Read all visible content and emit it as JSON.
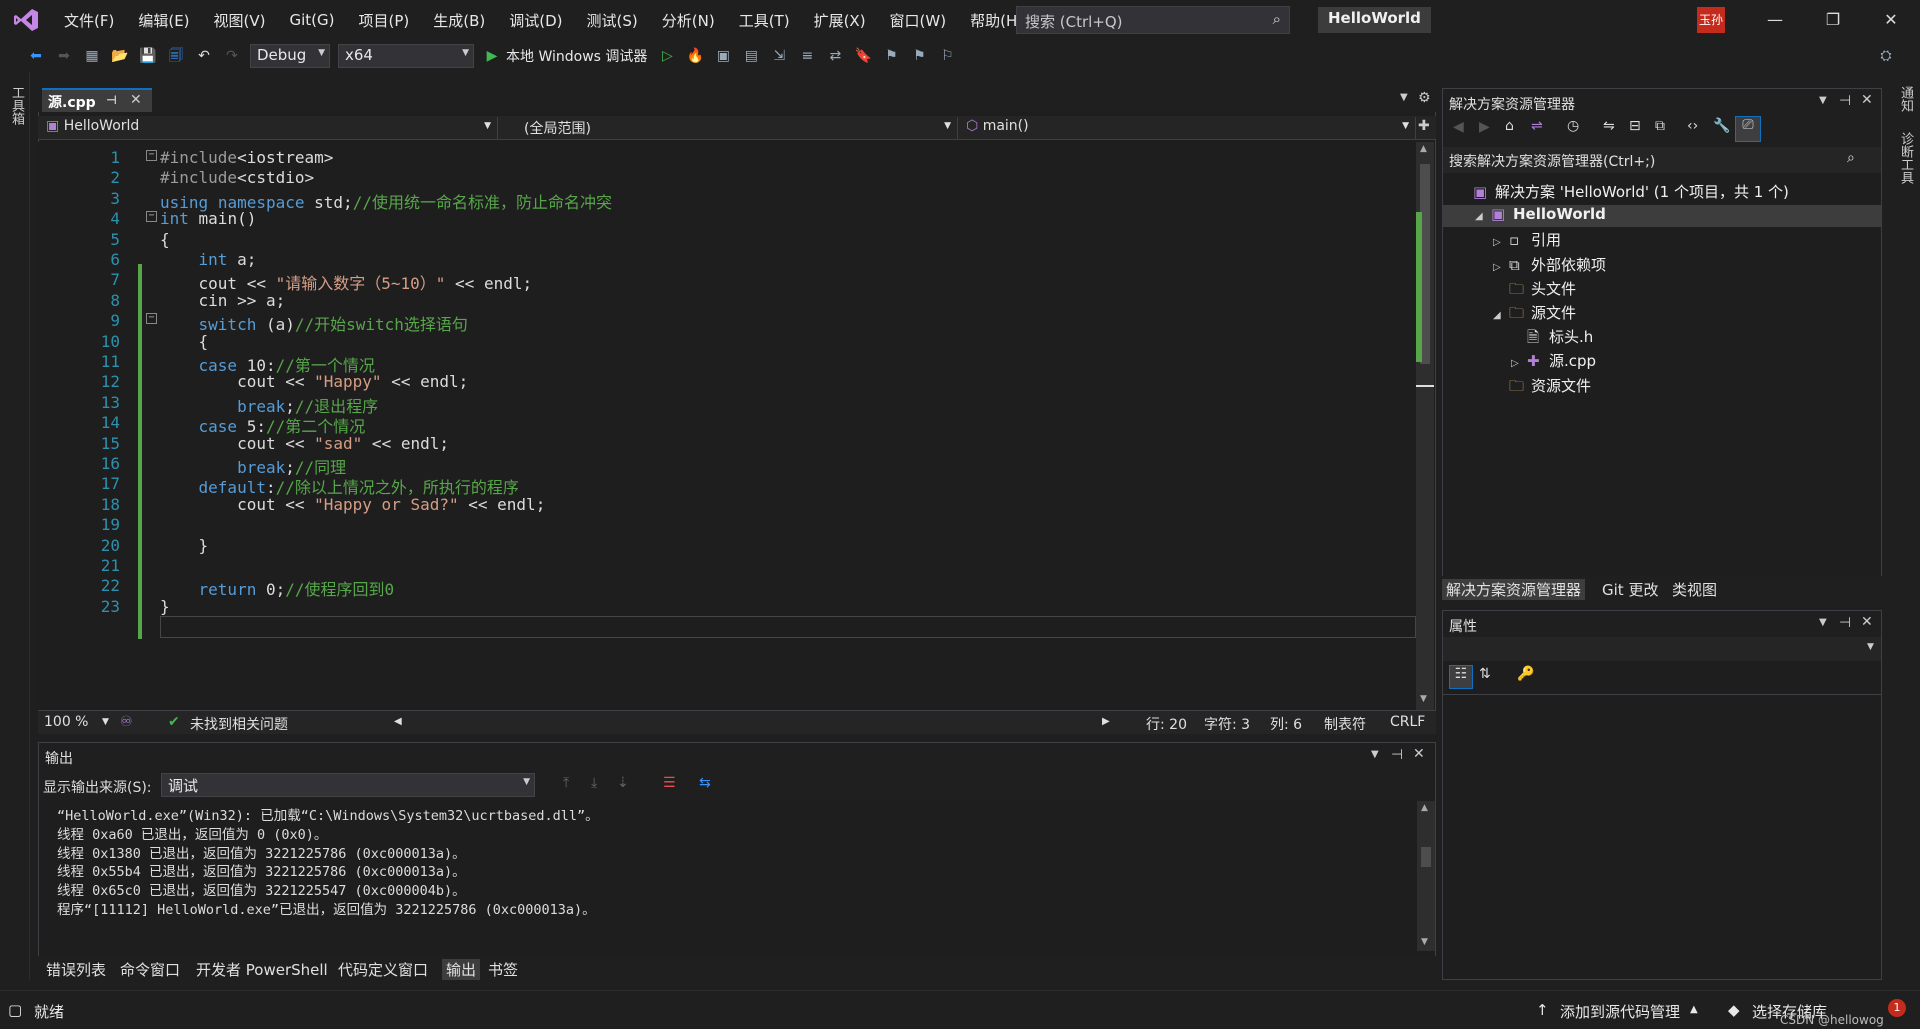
{
  "menu": [
    "文件(F)",
    "编辑(E)",
    "视图(V)",
    "Git(G)",
    "项目(P)",
    "生成(B)",
    "调试(D)",
    "测试(S)",
    "分析(N)",
    "工具(T)",
    "扩展(X)",
    "窗口(W)",
    "帮助(H)"
  ],
  "search": {
    "placeholder": "搜索 (Ctrl+Q)"
  },
  "app_title": "HelloWorld",
  "user_badge": "玉孙",
  "toolbar": {
    "config": "Debug",
    "platform": "x64",
    "debugger": "本地 Windows 调试器"
  },
  "left_tool_label": "工具箱",
  "right_tool_labels": [
    "通知",
    "诊断工具"
  ],
  "doc_tab": "源.cpp",
  "nav": {
    "project": "HelloWorld",
    "scope": "(全局范围)",
    "member": "main()"
  },
  "code_lines": [
    {
      "n": "1",
      "html": "<span class='pp'>#include</span>&lt;iostream&gt;"
    },
    {
      "n": "2",
      "html": "<span class='pp'>#include</span>&lt;cstdio&gt;"
    },
    {
      "n": "3",
      "html": "<span class='kw'>using</span> <span class='kw'>namespace</span> std;<span class='cm'>//使用统一命名标准，防止命名冲突</span>"
    },
    {
      "n": "4",
      "html": "<span class='kw'>int</span> main()"
    },
    {
      "n": "5",
      "html": "{"
    },
    {
      "n": "6",
      "html": "    <span class='kw'>int</span> a;"
    },
    {
      "n": "7",
      "html": "    cout &lt;&lt; <span class='str'>\"请输入数字（5~10）\"</span> &lt;&lt; endl;"
    },
    {
      "n": "8",
      "html": "    cin &gt;&gt; a;"
    },
    {
      "n": "9",
      "html": "    <span class='kw'>switch</span> (a)<span class='cm'>//开始switch选择语句</span>"
    },
    {
      "n": "10",
      "html": "    {"
    },
    {
      "n": "11",
      "html": "    <span class='kw'>case</span> 10:<span class='cm'>//第一个情况</span>"
    },
    {
      "n": "12",
      "html": "        cout &lt;&lt; <span class='str'>\"Happy\"</span> &lt;&lt; endl;"
    },
    {
      "n": "13",
      "html": "        <span class='kw'>break</span>;<span class='cm'>//退出程序</span>"
    },
    {
      "n": "14",
      "html": "    <span class='kw'>case</span> 5:<span class='cm'>//第二个情况</span>"
    },
    {
      "n": "15",
      "html": "        cout &lt;&lt; <span class='str'>\"sad\"</span> &lt;&lt; endl;"
    },
    {
      "n": "16",
      "html": "        <span class='kw'>break</span>;<span class='cm'>//同理</span>"
    },
    {
      "n": "17",
      "html": "    <span class='kw'>default</span>:<span class='cm'>//除以上情况之外，所执行的程序</span>"
    },
    {
      "n": "18",
      "html": "        cout &lt;&lt; <span class='str'>\"Happy or Sad?\"</span> &lt;&lt; endl;"
    },
    {
      "n": "19",
      "html": ""
    },
    {
      "n": "20",
      "html": "    }"
    },
    {
      "n": "21",
      "html": ""
    },
    {
      "n": "22",
      "html": "    <span class='kw'>return</span> 0;<span class='cm'>//使程序回到0</span>"
    },
    {
      "n": "23",
      "html": "}"
    }
  ],
  "status": {
    "zoom": "100 %",
    "issues": "未找到相关问题",
    "line": "行: 20",
    "char": "字符: 3",
    "col": "列: 6",
    "tabs": "制表符",
    "eol": "CRLF"
  },
  "output": {
    "title": "输出",
    "source_label": "显示输出来源(S):",
    "source_value": "调试",
    "lines": [
      "“HelloWorld.exe”(Win32): 已加载“C:\\Windows\\System32\\ucrtbased.dll”。",
      "线程 0xa60 已退出，返回值为 0 (0x0)。",
      "线程 0x1380 已退出，返回值为 3221225786 (0xc000013a)。",
      "线程 0x55b4 已退出，返回值为 3221225786 (0xc000013a)。",
      "线程 0x65c0 已退出，返回值为 3221225547 (0xc000004b)。",
      "程序“[11112] HelloWorld.exe”已退出，返回值为 3221225786 (0xc000013a)。"
    ]
  },
  "bottom_tabs": [
    "错误列表",
    "命令窗口",
    "开发者 PowerShell",
    "代码定义窗口",
    "输出",
    "书签"
  ],
  "solution": {
    "title": "解决方案资源管理器",
    "search": "搜索解决方案资源管理器(Ctrl+;)",
    "items": [
      {
        "label": "解决方案 'HelloWorld' (1 个项目，共 1 个)",
        "indent": 0
      },
      {
        "label": "HelloWorld",
        "indent": 1
      },
      {
        "label": "引用",
        "indent": 2
      },
      {
        "label": "外部依赖项",
        "indent": 2
      },
      {
        "label": "头文件",
        "indent": 2
      },
      {
        "label": "源文件",
        "indent": 2
      },
      {
        "label": "标头.h",
        "indent": 3
      },
      {
        "label": "源.cpp",
        "indent": 3
      },
      {
        "label": "资源文件",
        "indent": 2
      }
    ],
    "tabs": [
      "解决方案资源管理器",
      "Git 更改",
      "类视图"
    ]
  },
  "properties": {
    "title": "属性"
  },
  "statusbar": {
    "ready": "就绪",
    "add_source": "添加到源代码管理",
    "select_repo": "选择存储库",
    "watermark": "CSDN @hellowog",
    "notif_count": "1"
  }
}
